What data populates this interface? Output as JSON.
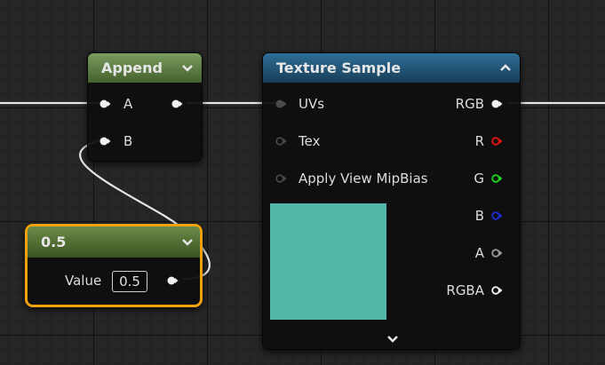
{
  "nodes": {
    "append": {
      "title": "Append",
      "inputs": [
        {
          "label": "A"
        },
        {
          "label": "B"
        }
      ]
    },
    "texture_sample": {
      "title": "Texture Sample",
      "inputs": [
        {
          "label": "UVs"
        },
        {
          "label": "Tex"
        },
        {
          "label": "Apply View MipBias"
        }
      ],
      "outputs": [
        {
          "label": "RGB",
          "color": "#ffffff"
        },
        {
          "label": "R",
          "color": "#e01414"
        },
        {
          "label": "G",
          "color": "#1ed21e"
        },
        {
          "label": "B",
          "color": "#1a2bd4"
        },
        {
          "label": "A",
          "color": "#9a9a9a"
        },
        {
          "label": "RGBA",
          "color": "#ffffff"
        }
      ],
      "preview_color": "#53b8a7"
    },
    "constant": {
      "title": "0.5",
      "value_label": "Value",
      "value": "0.5"
    }
  },
  "colors": {
    "selection_outline": "#f3a20c",
    "wire": "#e6e6e6"
  }
}
